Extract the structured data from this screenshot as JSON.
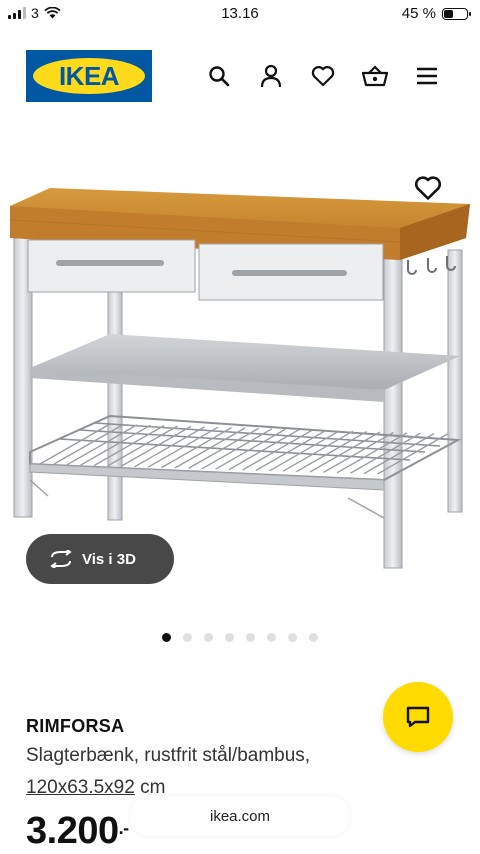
{
  "status_bar": {
    "carrier": "3",
    "time": "13.16",
    "battery_percent": "45 %",
    "battery_level": 0.45
  },
  "header": {
    "logo": "IKEA",
    "icons": [
      "search-icon",
      "account-icon",
      "favourites-icon",
      "basket-icon",
      "menu-icon"
    ]
  },
  "gallery": {
    "view_3d_label": "Vis i 3D",
    "slide_count": 8,
    "active_slide": 1
  },
  "product": {
    "name": "RIMFORSA",
    "description": "Slagterbænk, rustfrit stål/bambus,",
    "dimensions": "120x63.5x92",
    "dimension_unit": " cm",
    "price_main": "3.200",
    "price_suffix": ".-"
  },
  "browser": {
    "url": "ikea.com"
  },
  "colors": {
    "ikea_blue": "#0058a3",
    "ikea_yellow": "#ffda1a",
    "chat_yellow": "#ffdb00"
  }
}
